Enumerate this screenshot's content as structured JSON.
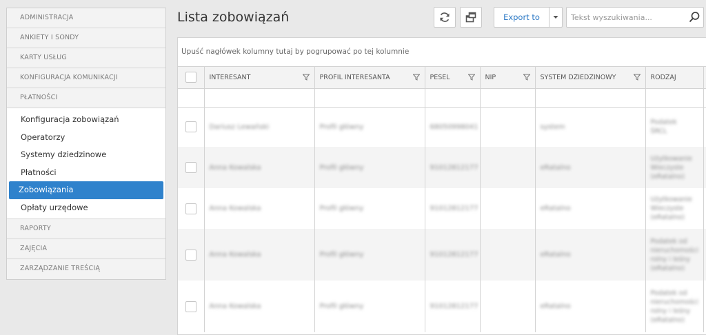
{
  "sidebar": {
    "sections_top": [
      "ADMINISTRACJA",
      "ANKIETY I SONDY",
      "KARTY USŁUG",
      "KONFIGURACJA KOMUNIKACJI",
      "PŁATNOŚCI"
    ],
    "payments_items": [
      "Konfiguracja zobowiązań",
      "Operatorzy",
      "Systemy dziedzinowe",
      "Płatności",
      "Zobowiązania",
      "Opłaty urzędowe"
    ],
    "sections_bottom": [
      "RAPORTY",
      "ZAJĘCIA",
      "ZARZĄDZANIE TREŚCIĄ"
    ],
    "active_item": "Zobowiązania"
  },
  "header": {
    "title": "Lista zobowiązań",
    "export_label": "Export to",
    "search_placeholder": "Tekst wyszukiwania..."
  },
  "grid": {
    "group_panel_text": "Upuść nagłówek kolumny tutaj by pogrupować po tej kolumnie",
    "columns": [
      "INTERESANT",
      "PROFIL INTERESANTA",
      "PESEL",
      "NIP",
      "SYSTEM DZIEDZINOWY",
      "RODZAJ"
    ],
    "rows": [
      {
        "interesant": "Dariusz Lewański",
        "profil": "Profil główny",
        "pesel": "68050998041",
        "nip": "",
        "system": "system",
        "rodzaj": [
          "Podatek",
          "ŚRCL"
        ],
        "mark": "c",
        "height": 58
      },
      {
        "interesant": "Anna Kowalska",
        "profil": "Profil główny",
        "pesel": "91012812177",
        "nip": "",
        "system": "eRatalno",
        "rodzaj": [
          "Użytkowanie",
          "Wieczyste",
          "(eRatalno)"
        ],
        "mark": "",
        "height": 60
      },
      {
        "interesant": "Anna Kowalska",
        "profil": "Profil główny",
        "pesel": "91012812177",
        "nip": "",
        "system": "eRatalno",
        "rodzaj": [
          "Użytkowanie",
          "Wieczyste",
          "(eRatalno)"
        ],
        "mark": "",
        "height": 59
      },
      {
        "interesant": "Anna Kowalska",
        "profil": "Profil główny",
        "pesel": "91012812177",
        "nip": "",
        "system": "eRatalno",
        "rodzaj": [
          "Podatek od",
          "nieruchomości",
          "rolny i leśny",
          "(eRatalno)"
        ],
        "mark": "4",
        "height": 75
      },
      {
        "interesant": "Anna Kowalska",
        "profil": "Profil główny",
        "pesel": "91012812177",
        "nip": "",
        "system": "eRatalno",
        "rodzaj": [
          "Podatek od",
          "nieruchomości",
          "rolny i leśny",
          "(eRatalno)"
        ],
        "mark": "4",
        "height": 75
      }
    ]
  }
}
